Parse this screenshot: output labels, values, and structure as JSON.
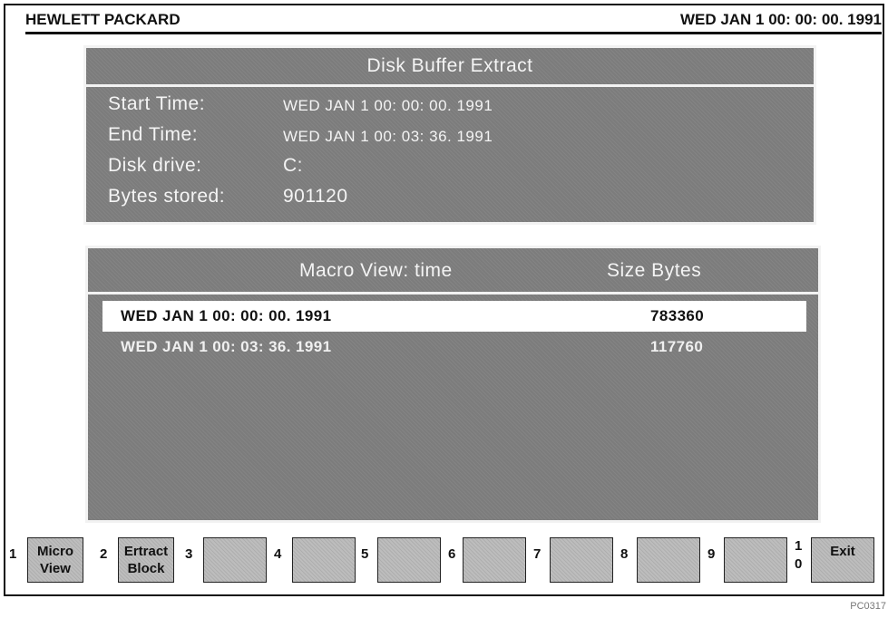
{
  "header": {
    "brand": "HEWLETT PACKARD",
    "datetime": "WED JAN 1 00: 00: 00. 1991"
  },
  "buffer_panel": {
    "title": "Disk Buffer Extract",
    "fields": [
      {
        "label": "Start Time:",
        "value": "WED JAN 1 00: 00: 00. 1991"
      },
      {
        "label": "End Time:",
        "value": "WED JAN 1 00: 03: 36. 1991"
      },
      {
        "label": "Disk drive:",
        "value": "C:"
      },
      {
        "label": "Bytes stored:",
        "value": "901120"
      }
    ]
  },
  "macro_panel": {
    "col_time": "Macro View: time",
    "col_size": "Size Bytes",
    "rows": [
      {
        "time": "WED JAN 1 00: 00: 00. 1991",
        "size": "783360",
        "selected": true
      },
      {
        "time": "WED JAN 1 00: 03: 36. 1991",
        "size": "117760",
        "selected": false
      }
    ]
  },
  "function_keys": [
    {
      "num": "1",
      "line1": "Micro",
      "line2": "View"
    },
    {
      "num": "2",
      "line1": "Ertract",
      "line2": "Block"
    },
    {
      "num": "3",
      "line1": "",
      "line2": ""
    },
    {
      "num": "4",
      "line1": "",
      "line2": ""
    },
    {
      "num": "5",
      "line1": "",
      "line2": ""
    },
    {
      "num": "6",
      "line1": "",
      "line2": ""
    },
    {
      "num": "7",
      "line1": "",
      "line2": ""
    },
    {
      "num": "8",
      "line1": "",
      "line2": ""
    },
    {
      "num": "9",
      "line1": "",
      "line2": ""
    },
    {
      "num_top": "1",
      "num_bottom": "0",
      "line1": "Exit",
      "line2": ""
    }
  ],
  "footer_code": "PC0317"
}
